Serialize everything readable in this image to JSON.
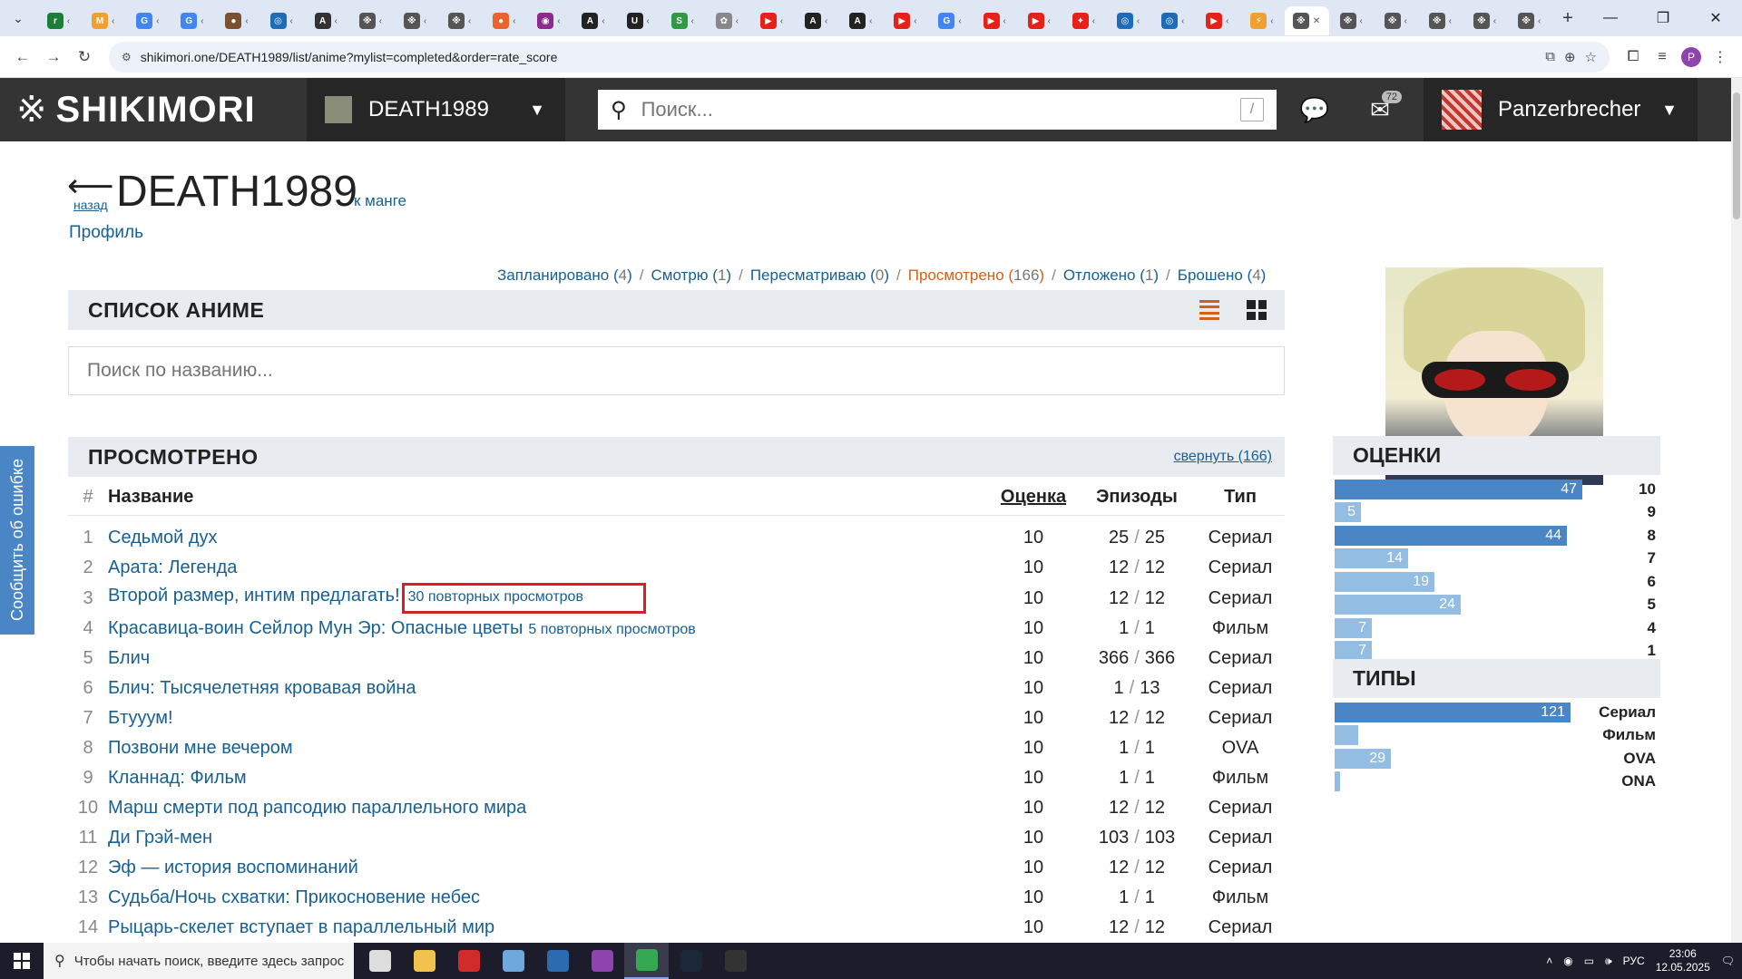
{
  "browser": {
    "tabs": [
      {
        "letter": "r",
        "color": "#1a7f37"
      },
      {
        "letter": "M",
        "color": "#f0a030"
      },
      {
        "letter": "G",
        "color": "#4285f4"
      },
      {
        "letter": "G",
        "color": "#4285f4"
      },
      {
        "letter": "●",
        "color": "#7a5230"
      },
      {
        "letter": "◎",
        "color": "#1e6bb8"
      },
      {
        "letter": "A",
        "color": "#333333"
      },
      {
        "letter": "※",
        "color": "#555555"
      },
      {
        "letter": "※",
        "color": "#555555"
      },
      {
        "letter": "※",
        "color": "#555555"
      },
      {
        "letter": "●",
        "color": "#e8642c"
      },
      {
        "letter": "◉",
        "color": "#8e2a8e"
      },
      {
        "letter": "A",
        "color": "#222222"
      },
      {
        "letter": "U",
        "color": "#222222"
      },
      {
        "letter": "S",
        "color": "#2e9a44"
      },
      {
        "letter": "✿",
        "color": "#888888"
      },
      {
        "letter": "▶",
        "color": "#e62117"
      },
      {
        "letter": "A",
        "color": "#222222"
      },
      {
        "letter": "A",
        "color": "#222222"
      },
      {
        "letter": "▶",
        "color": "#e62117"
      },
      {
        "letter": "G",
        "color": "#4285f4"
      },
      {
        "letter": "▶",
        "color": "#e62117"
      },
      {
        "letter": "▶",
        "color": "#e62117"
      },
      {
        "letter": "✦",
        "color": "#e62117"
      },
      {
        "letter": "◎",
        "color": "#1e6bb8"
      },
      {
        "letter": "◎",
        "color": "#1e6bb8"
      },
      {
        "letter": "▶",
        "color": "#e62117"
      },
      {
        "letter": "⚡",
        "color": "#f0a030"
      }
    ],
    "active_tab": {
      "letter": "※",
      "color": "#555555"
    },
    "trailing_tabs": [
      {
        "letter": "※",
        "color": "#555555"
      },
      {
        "letter": "※",
        "color": "#555555"
      },
      {
        "letter": "※",
        "color": "#555555"
      },
      {
        "letter": "※",
        "color": "#555555"
      },
      {
        "letter": "※",
        "color": "#555555"
      }
    ],
    "url": "shikimori.one/DEATH1989/list/anime?mylist=completed&order=rate_score",
    "profile_letter": "P"
  },
  "header": {
    "logo": "SHIKIMORI",
    "viewed_user": "DEATH1989",
    "search_placeholder": "Поиск...",
    "search_hotkey": "/",
    "mail_count": "72",
    "me": "Panzerbrecher"
  },
  "report_tab": "Сообщить об ошибке",
  "page": {
    "back_label": "назад",
    "title": "DEATH1989",
    "to_manga": "к манге",
    "profile_link": "Профиль"
  },
  "status_filter": [
    {
      "label": "Запланировано",
      "count": "4",
      "active": false
    },
    {
      "label": "Смотрю",
      "count": "1",
      "active": false
    },
    {
      "label": "Пересматриваю",
      "count": "0",
      "active": false
    },
    {
      "label": "Просмотрено",
      "count": "166",
      "active": true
    },
    {
      "label": "Отложено",
      "count": "1",
      "active": false
    },
    {
      "label": "Брошено",
      "count": "4",
      "active": false
    }
  ],
  "list": {
    "title": "СПИСОК АНИМЕ",
    "filter_placeholder": "Поиск по названию...",
    "section_title": "ПРОСМОТРЕНО",
    "collapse_label": "свернуть (166)",
    "columns": {
      "num": "#",
      "title": "Название",
      "score": "Оценка",
      "episodes": "Эпизоды",
      "type": "Тип"
    },
    "rows": [
      {
        "n": "1",
        "title": "Седьмой дух",
        "rewatch": "",
        "score": "10",
        "ep_done": "25",
        "ep_total": "25",
        "type": "Сериал"
      },
      {
        "n": "2",
        "title": "Арата: Легенда",
        "rewatch": "",
        "score": "10",
        "ep_done": "12",
        "ep_total": "12",
        "type": "Сериал"
      },
      {
        "n": "3",
        "title": "Второй размер, интим предлагать!",
        "rewatch": "30 повторных просмотров",
        "score": "10",
        "ep_done": "12",
        "ep_total": "12",
        "type": "Сериал",
        "highlight": true
      },
      {
        "n": "4",
        "title": "Красавица-воин Сейлор Мун Эр: Опасные цветы",
        "rewatch": "5 повторных просмотров",
        "score": "10",
        "ep_done": "1",
        "ep_total": "1",
        "type": "Фильм"
      },
      {
        "n": "5",
        "title": "Блич",
        "rewatch": "",
        "score": "10",
        "ep_done": "366",
        "ep_total": "366",
        "type": "Сериал"
      },
      {
        "n": "6",
        "title": "Блич: Тысячелетняя кровавая война",
        "rewatch": "",
        "score": "10",
        "ep_done": "1",
        "ep_total": "13",
        "type": "Сериал"
      },
      {
        "n": "7",
        "title": "Бтууум!",
        "rewatch": "",
        "score": "10",
        "ep_done": "12",
        "ep_total": "12",
        "type": "Сериал"
      },
      {
        "n": "8",
        "title": "Позвони мне вечером",
        "rewatch": "",
        "score": "10",
        "ep_done": "1",
        "ep_total": "1",
        "type": "OVA"
      },
      {
        "n": "9",
        "title": "Кланнад: Фильм",
        "rewatch": "",
        "score": "10",
        "ep_done": "1",
        "ep_total": "1",
        "type": "Фильм"
      },
      {
        "n": "10",
        "title": "Марш смерти под рапсодию параллельного мира",
        "rewatch": "",
        "score": "10",
        "ep_done": "12",
        "ep_total": "12",
        "type": "Сериал"
      },
      {
        "n": "11",
        "title": "Ди Грэй-мен",
        "rewatch": "",
        "score": "10",
        "ep_done": "103",
        "ep_total": "103",
        "type": "Сериал"
      },
      {
        "n": "12",
        "title": "Эф — история воспоминаний",
        "rewatch": "",
        "score": "10",
        "ep_done": "12",
        "ep_total": "12",
        "type": "Сериал"
      },
      {
        "n": "13",
        "title": "Судьба/Ночь схватки: Прикосновение небес",
        "rewatch": "",
        "score": "10",
        "ep_done": "1",
        "ep_total": "1",
        "type": "Фильм"
      },
      {
        "n": "14",
        "title": "Рыцарь-скелет вступает в параллельный мир",
        "rewatch": "",
        "score": "10",
        "ep_done": "12",
        "ep_total": "12",
        "type": "Сериал"
      }
    ]
  },
  "sidebar": {
    "scores_title": "ОЦЕНКИ",
    "scores": [
      {
        "label": "10",
        "value": 47,
        "text": "47",
        "dark": true
      },
      {
        "label": "9",
        "value": 5,
        "text": "5",
        "dark": false
      },
      {
        "label": "8",
        "value": 44,
        "text": "44",
        "dark": true
      },
      {
        "label": "7",
        "value": 14,
        "text": "14",
        "dark": false
      },
      {
        "label": "6",
        "value": 19,
        "text": "19",
        "dark": false
      },
      {
        "label": "5",
        "value": 24,
        "text": "24",
        "dark": false
      },
      {
        "label": "4",
        "value": 7,
        "text": "7",
        "dark": false
      },
      {
        "label": "1",
        "value": 7,
        "text": "7",
        "dark": false
      }
    ],
    "types_title": "ТИПЫ",
    "types": [
      {
        "label": "Сериал",
        "value": 121,
        "text": "121",
        "dark": true
      },
      {
        "label": "Фильм",
        "value": 12,
        "text": "",
        "dark": false
      },
      {
        "label": "OVA",
        "value": 29,
        "text": "29",
        "dark": false
      },
      {
        "label": "ONA",
        "value": 2,
        "text": "",
        "dark": false
      }
    ]
  },
  "taskbar": {
    "search_placeholder": "Чтобы начать поиск, введите здесь запрос",
    "apps": [
      {
        "name": "task-view",
        "color": "#dddddd",
        "active": false
      },
      {
        "name": "explorer",
        "color": "#f2c14e",
        "active": false
      },
      {
        "name": "flash",
        "color": "#d12b2b",
        "active": false
      },
      {
        "name": "paint",
        "color": "#6fa8dc",
        "active": false
      },
      {
        "name": "terminal",
        "color": "#2b6cb0",
        "active": false
      },
      {
        "name": "tor",
        "color": "#8e44ad",
        "active": false
      },
      {
        "name": "chrome",
        "color": "#34a853",
        "active": true
      },
      {
        "name": "steam",
        "color": "#1b2838",
        "active": false
      },
      {
        "name": "ftl",
        "color": "#333333",
        "active": false
      }
    ],
    "lang": "РУС",
    "time": "23:06",
    "date": "12.05.2025"
  }
}
